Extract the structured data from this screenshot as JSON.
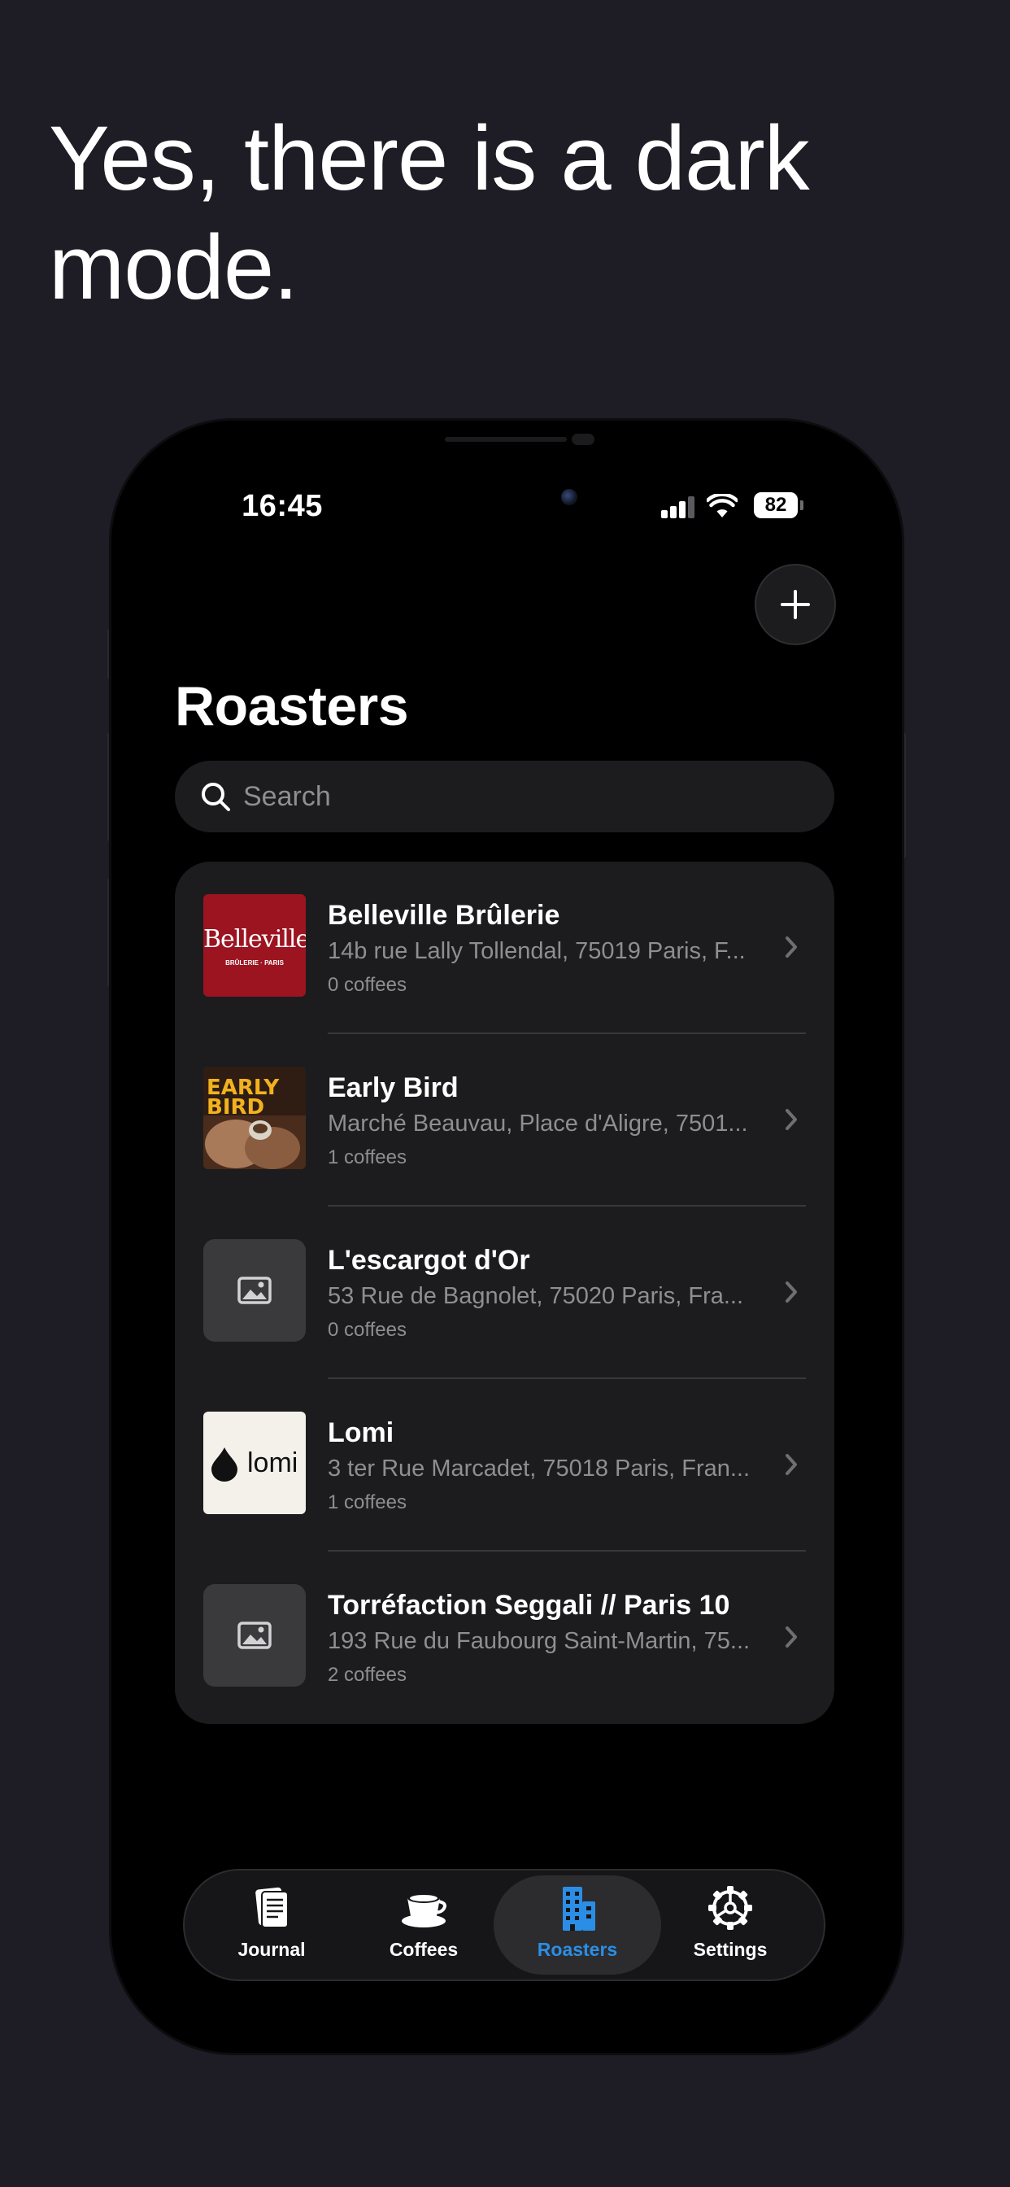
{
  "headline": "Yes, there is a dark mode.",
  "status_bar": {
    "time": "16:45",
    "battery": "82"
  },
  "header": {
    "add_icon": "plus-icon",
    "title": "Roasters"
  },
  "search": {
    "placeholder": "Search",
    "icon": "search-icon"
  },
  "roasters": [
    {
      "name": "Belleville Brûlerie",
      "address": "14b rue Lally Tollendal, 75019 Paris, F...",
      "count": "0 coffees",
      "logo_text": "Belleville",
      "logo_sub": "BRÛLERIE · PARIS"
    },
    {
      "name": "Early Bird",
      "address": "Marché Beauvau, Place d'Aligre, 7501...",
      "count": "1 coffees",
      "logo_text": "EARLY BIRD"
    },
    {
      "name": "L'escargot d'Or",
      "address": "53 Rue de Bagnolet, 75020 Paris, Fra...",
      "count": "0 coffees",
      "logo_icon": "image-placeholder-icon"
    },
    {
      "name": "Lomi",
      "address": "3 ter Rue Marcadet, 75018 Paris, Fran...",
      "count": "1 coffees",
      "logo_text": "lomi"
    },
    {
      "name": "Torréfaction Seggali // Paris 10",
      "address": "193 Rue du Faubourg Saint-Martin, 75...",
      "count": "2 coffees",
      "logo_icon": "image-placeholder-icon"
    }
  ],
  "tabs": [
    {
      "label": "Journal",
      "icon": "journal-icon",
      "active": false
    },
    {
      "label": "Coffees",
      "icon": "coffee-cup-icon",
      "active": false
    },
    {
      "label": "Roasters",
      "icon": "building-icon",
      "active": true
    },
    {
      "label": "Settings",
      "icon": "gear-icon",
      "active": false
    }
  ],
  "colors": {
    "background": "#1e1c24",
    "screen": "#000000",
    "card": "#1c1c1e",
    "secondary_text": "#8e8e93",
    "accent": "#2b8ee6",
    "belleville_red": "#9b1420"
  }
}
